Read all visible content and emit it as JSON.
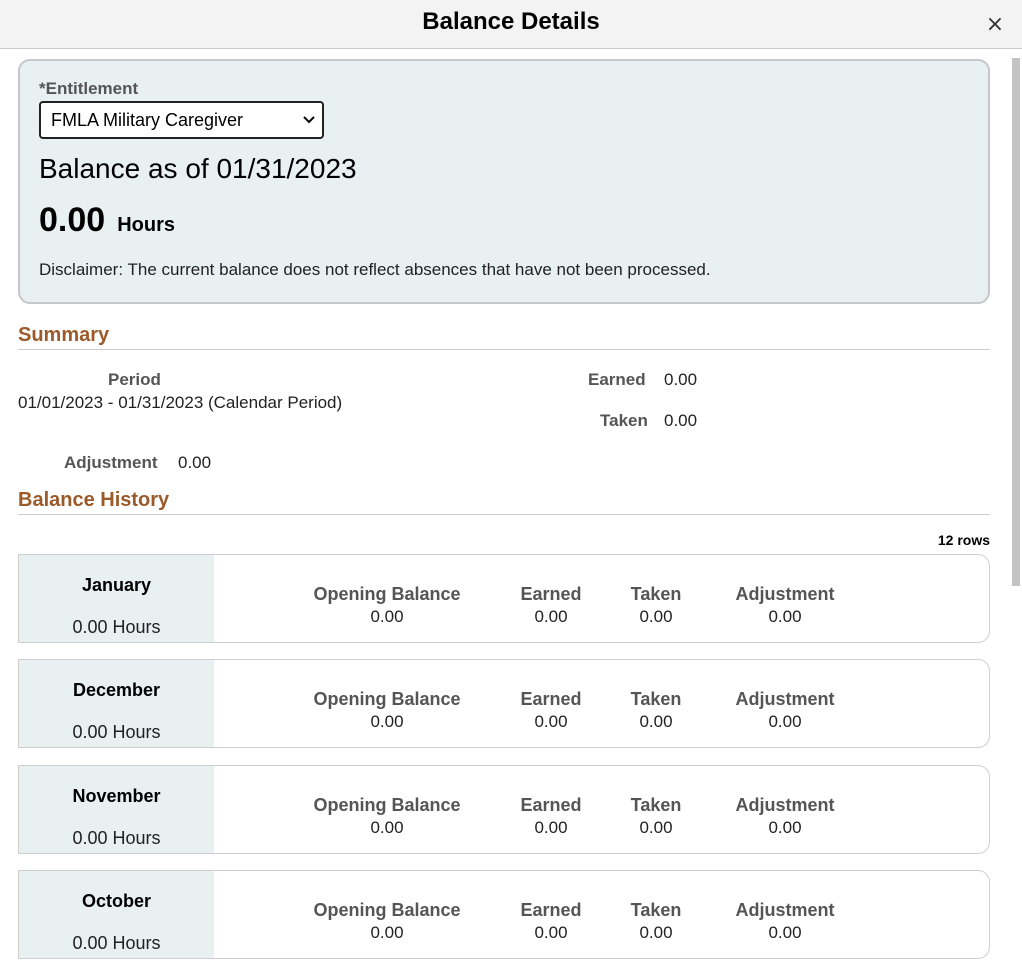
{
  "header": {
    "title": "Balance Details",
    "close_symbol": "×"
  },
  "entitlement": {
    "label": "*Entitlement",
    "selected": "FMLA Military Caregiver"
  },
  "balance": {
    "as_of": "Balance as of 01/31/2023",
    "amount": "0.00",
    "unit": "Hours",
    "disclaimer": "Disclaimer: The current balance does not reflect absences that have not been processed."
  },
  "summary": {
    "heading": "Summary",
    "period_label": "Period",
    "period_value": "01/01/2023 - 01/31/2023 (Calendar Period)",
    "earned_label": "Earned",
    "earned_value": "0.00",
    "taken_label": "Taken",
    "taken_value": "0.00",
    "adjustment_label": "Adjustment",
    "adjustment_value": "0.00"
  },
  "history": {
    "heading": "Balance History",
    "row_count": "12 rows",
    "col_labels": {
      "opening": "Opening Balance",
      "earned": "Earned",
      "taken": "Taken",
      "adjustment": "Adjustment"
    },
    "rows": [
      {
        "month": "January",
        "hours": "0.00 Hours",
        "opening": "0.00",
        "earned": "0.00",
        "taken": "0.00",
        "adjustment": "0.00"
      },
      {
        "month": "December",
        "hours": "0.00 Hours",
        "opening": "0.00",
        "earned": "0.00",
        "taken": "0.00",
        "adjustment": "0.00"
      },
      {
        "month": "November",
        "hours": "0.00 Hours",
        "opening": "0.00",
        "earned": "0.00",
        "taken": "0.00",
        "adjustment": "0.00"
      },
      {
        "month": "October",
        "hours": "0.00 Hours",
        "opening": "0.00",
        "earned": "0.00",
        "taken": "0.00",
        "adjustment": "0.00"
      }
    ]
  },
  "colors": {
    "section_heading": "#9b5a2a",
    "panel_bg": "#e8f0f2"
  }
}
